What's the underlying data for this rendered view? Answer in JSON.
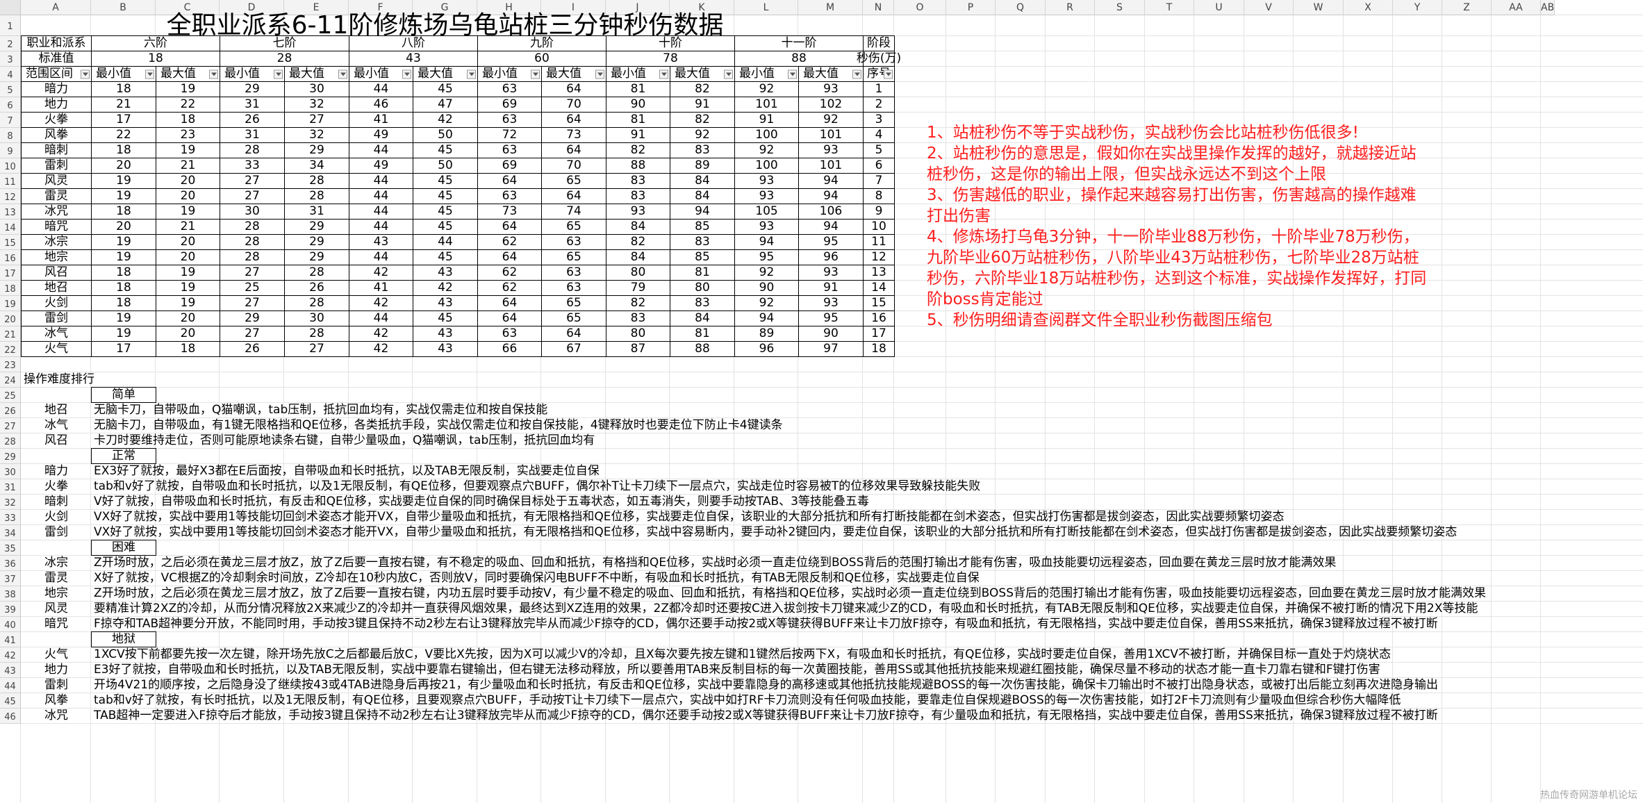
{
  "title": "全职业派系6-11阶修炼场乌龟站桩三分钟秒伤数据",
  "column_headers": [
    "A",
    "B",
    "C",
    "D",
    "E",
    "F",
    "G",
    "H",
    "I",
    "J",
    "K",
    "L",
    "M",
    "N",
    "O",
    "P",
    "Q",
    "R",
    "S",
    "T",
    "U",
    "V",
    "W",
    "X",
    "Y",
    "Z",
    "AA",
    "AB"
  ],
  "row_numbers": [
    "1",
    "2",
    "3",
    "4",
    "5",
    "6",
    "7",
    "8",
    "9",
    "10",
    "11",
    "12",
    "13",
    "14",
    "15",
    "16",
    "17",
    "18",
    "19",
    "20",
    "21",
    "22",
    "23",
    "24",
    "25",
    "26",
    "27",
    "28",
    "29",
    "30",
    "31",
    "32",
    "33",
    "34",
    "35",
    "36",
    "37",
    "38",
    "39",
    "40",
    "41",
    "42",
    "43",
    "44",
    "45",
    "46"
  ],
  "table": {
    "row2": {
      "a": "职业和派系",
      "tiers": [
        "六阶",
        "七阶",
        "八阶",
        "九阶",
        "十阶",
        "十一阶"
      ],
      "stage": "阶段"
    },
    "row3": {
      "a": "标准值",
      "standards": [
        "18",
        "28",
        "43",
        "60",
        "78",
        "88"
      ],
      "unit": "秒伤(万)"
    },
    "row4": {
      "a": "范围区间",
      "min": "最小值",
      "max": "最大值",
      "seq": "序号"
    },
    "rows": [
      {
        "name": "暗力",
        "v": [
          "18",
          "19",
          "29",
          "30",
          "44",
          "45",
          "63",
          "64",
          "81",
          "82",
          "92",
          "93"
        ],
        "n": "1"
      },
      {
        "name": "地力",
        "v": [
          "21",
          "22",
          "31",
          "32",
          "46",
          "47",
          "69",
          "70",
          "90",
          "91",
          "101",
          "102"
        ],
        "n": "2"
      },
      {
        "name": "火拳",
        "v": [
          "17",
          "18",
          "26",
          "27",
          "41",
          "42",
          "63",
          "64",
          "81",
          "82",
          "91",
          "92"
        ],
        "n": "3"
      },
      {
        "name": "风拳",
        "v": [
          "22",
          "23",
          "31",
          "32",
          "49",
          "50",
          "72",
          "73",
          "91",
          "92",
          "100",
          "101"
        ],
        "n": "4"
      },
      {
        "name": "暗刺",
        "v": [
          "18",
          "19",
          "28",
          "29",
          "44",
          "45",
          "63",
          "64",
          "82",
          "83",
          "92",
          "93"
        ],
        "n": "5"
      },
      {
        "name": "雷刺",
        "v": [
          "20",
          "21",
          "33",
          "34",
          "49",
          "50",
          "69",
          "70",
          "88",
          "89",
          "100",
          "101"
        ],
        "n": "6"
      },
      {
        "name": "风灵",
        "v": [
          "19",
          "20",
          "27",
          "28",
          "44",
          "45",
          "64",
          "65",
          "83",
          "84",
          "93",
          "94"
        ],
        "n": "7"
      },
      {
        "name": "雷灵",
        "v": [
          "19",
          "20",
          "27",
          "28",
          "44",
          "45",
          "63",
          "64",
          "83",
          "84",
          "93",
          "94"
        ],
        "n": "8"
      },
      {
        "name": "冰咒",
        "v": [
          "18",
          "19",
          "30",
          "31",
          "44",
          "45",
          "73",
          "74",
          "93",
          "94",
          "105",
          "106"
        ],
        "n": "9"
      },
      {
        "name": "暗咒",
        "v": [
          "20",
          "21",
          "28",
          "29",
          "44",
          "45",
          "64",
          "65",
          "84",
          "85",
          "93",
          "94"
        ],
        "n": "10"
      },
      {
        "name": "冰宗",
        "v": [
          "19",
          "20",
          "28",
          "29",
          "43",
          "44",
          "62",
          "63",
          "82",
          "83",
          "94",
          "95"
        ],
        "n": "11"
      },
      {
        "name": "地宗",
        "v": [
          "19",
          "20",
          "28",
          "29",
          "44",
          "45",
          "64",
          "65",
          "84",
          "85",
          "95",
          "96"
        ],
        "n": "12"
      },
      {
        "name": "风召",
        "v": [
          "18",
          "19",
          "27",
          "28",
          "42",
          "43",
          "62",
          "63",
          "80",
          "81",
          "92",
          "93"
        ],
        "n": "13"
      },
      {
        "name": "地召",
        "v": [
          "18",
          "19",
          "25",
          "26",
          "41",
          "42",
          "62",
          "63",
          "79",
          "80",
          "90",
          "91"
        ],
        "n": "14"
      },
      {
        "name": "火剑",
        "v": [
          "18",
          "19",
          "27",
          "28",
          "42",
          "43",
          "64",
          "65",
          "82",
          "83",
          "92",
          "93"
        ],
        "n": "15"
      },
      {
        "name": "雷剑",
        "v": [
          "19",
          "20",
          "29",
          "30",
          "44",
          "45",
          "64",
          "65",
          "83",
          "84",
          "94",
          "95"
        ],
        "n": "16"
      },
      {
        "name": "冰气",
        "v": [
          "19",
          "20",
          "27",
          "28",
          "42",
          "43",
          "63",
          "64",
          "80",
          "81",
          "89",
          "90"
        ],
        "n": "17"
      },
      {
        "name": "火气",
        "v": [
          "17",
          "18",
          "26",
          "27",
          "42",
          "43",
          "66",
          "67",
          "87",
          "88",
          "96",
          "97"
        ],
        "n": "18"
      }
    ]
  },
  "notes": [
    "1、站桩秒伤不等于实战秒伤，实战秒伤会比站桩秒伤低很多!",
    "2、站桩秒伤的意思是，假如你在实战里操作发挥的越好，就越接近站桩秒伤，这是你的输出上限，但实战永远达不到这个上限",
    "3、伤害越低的职业，操作起来越容易打出伤害，伤害越高的操作越难打出伤害",
    "4、修炼场打乌龟3分钟，十一阶毕业88万秒伤，十阶毕业78万秒伤，九阶毕业60万站桩秒伤，八阶毕业43万站桩秒伤，七阶毕业28万站桩秒伤，六阶毕业18万站桩秒伤，达到这个标准，实战操作发挥好，打同阶boss肯定能过",
    "5、秒伤明细请查阅群文件全职业秒伤截图压缩包"
  ],
  "difficulty": {
    "heading": "操作难度排行",
    "lines": [
      {
        "type": "group",
        "label": "简单"
      },
      {
        "type": "item",
        "name": "地召",
        "text": "无脑卡刀，自带吸血，Q猫嘲讽，tab压制，抵抗回血均有，实战仅需走位和按自保技能"
      },
      {
        "type": "item",
        "name": "冰气",
        "text": "无脑卡刀，自带吸血，有1键无限格挡和QE位移，各类抵抗手段，实战仅需走位和按自保技能，4键释放时也要走位下防止卡4键读条"
      },
      {
        "type": "item",
        "name": "风召",
        "text": "卡刀时要维持走位，否则可能原地读条右键，自带少量吸血，Q猫嘲讽，tab压制，抵抗回血均有"
      },
      {
        "type": "group",
        "label": "正常"
      },
      {
        "type": "item",
        "name": "暗力",
        "text": "EX3好了就按，最好X3都在E后面按，自带吸血和长时抵抗，以及TAB无限反制，实战要走位自保"
      },
      {
        "type": "item",
        "name": "火拳",
        "text": "tab和v好了就按，自带吸血和长时抵抗，以及1无限反制，有QE位移，但要观察点穴BUFF，偶尔补T让卡刀续下一层点穴，实战走位时容易被T的位移效果导致躲技能失败"
      },
      {
        "type": "item",
        "name": "暗刺",
        "text": "V好了就按，自带吸血和长时抵抗，有反击和QE位移，实战要走位自保的同时确保目标处于五毒状态，如五毒消失，则要手动按TAB、3等技能叠五毒"
      },
      {
        "type": "item",
        "name": "火剑",
        "text": "VX好了就按，实战中要用1等技能切回剑术姿态才能开VX，自带少量吸血和抵抗，有无限格挡和QE位移，实战要走位自保，该职业的大部分抵抗和所有打断技能都在剑术姿态，但实战打伤害都是拔剑姿态，因此实战要频繁切姿态"
      },
      {
        "type": "item",
        "name": "雷剑",
        "text": "VX好了就按，实战中要用1等技能切回剑术姿态才能开VX，自带少量吸血和抵抗，有无限格挡和QE位移，实战中容易断内，要手动补2键回内，要走位自保，该职业的大部分抵抗和所有打断技能都在剑术姿态，但实战打伤害都是拔剑姿态，因此实战要频繁切姿态"
      },
      {
        "type": "group",
        "label": "困难"
      },
      {
        "type": "item",
        "name": "冰宗",
        "text": "Z开场时放，之后必须在黄龙三层才放Z，放了Z后要一直按右键，有不稳定的吸血、回血和抵抗，有格挡和QE位移，实战时必须一直走位绕到BOSS背后的范围打输出才能有伤害，吸血技能要切远程姿态，回血要在黄龙三层时放才能满效果"
      },
      {
        "type": "item",
        "name": "雷灵",
        "text": "X好了就按，VC根据Z的冷却剩余时间放，Z冷却在10秒内放C，否则放V，同时要确保闪电BUFF不中断，有吸血和长时抵抗，有TAB无限反制和QE位移，实战要走位自保"
      },
      {
        "type": "item",
        "name": "地宗",
        "text": "Z开场时放，之后必须在黄龙三层才放Z，放了Z后要一直按右键，内功五层时要手动按V，有少量不稳定的吸血、回血和抵抗，有格挡和QE位移，实战时必须一直走位绕到BOSS背后的范围打输出才能有伤害，吸血技能要切远程姿态，回血要在黄龙三层时放才能满效果"
      },
      {
        "type": "item",
        "name": "风灵",
        "text": "要精准计算2XZ的冷却，从而分情况释放2X来减少Z的冷却并一直获得风烟效果，最终达到XZ连用的效果，2Z都冷却时还要按C进入拔剑按卡刀键来减少Z的CD，有吸血和长时抵抗，有TAB无限反制和QE位移，实战要走位自保，并确保不被打断的情况下用2X等技能"
      },
      {
        "type": "item",
        "name": "暗咒",
        "text": "F掠夺和TAB超神要分开放，不能同时用，手动按3键且保持不动2秒左右让3键释放完毕从而减少F掠夺的CD，偶尔还要手动按2或X等键获得BUFF来让卡刀放F掠夺，有吸血和抵抗，有无限格挡，实战中要走位自保，善用SS来抵抗，确保3键释放过程不被打断"
      },
      {
        "type": "group",
        "label": "地狱"
      },
      {
        "type": "item",
        "name": "火气",
        "text": "1XCV按下前都要先按一次左键，除开场先放C之后都最后放C，V要比X先按，因为X可以减少V的冷却，且X每次要先按左键和1键然后按两下X，有吸血和长时抵抗，有QE位移，实战时要走位自保，善用1XCV不被打断，并确保目标一直处于灼烧状态"
      },
      {
        "type": "item",
        "name": "地力",
        "text": "E3好了就按，自带吸血和长时抵抗，以及TAB无限反制，实战中要靠右键输出，但右键无法移动释放，所以要善用TAB来反制目标的每一次黄圈技能，善用SS或其他抵抗技能来规避红圈技能，确保尽量不移动的状态才能一直卡刀靠右键和F键打伤害"
      },
      {
        "type": "item",
        "name": "雷刺",
        "text": "开场4V21的顺序按，之后隐身没了继续按43或4TAB进隐身后再按21，有少量吸血和长时抵抗，有反击和QE位移，实战中要靠隐身的高移速或其他抵抗技能规避BOSS的每一次伤害技能，确保卡刀输出时不被打出隐身状态，或被打出后能立刻再次进隐身输出"
      },
      {
        "type": "item",
        "name": "风拳",
        "text": "tab和v好了就按，有长时抵抗，以及1无限反制，有QE位移，且要观察点穴BUFF，手动按T让卡刀续下一层点穴，实战中如打RF卡刀流则没有任何吸血技能，要靠走位自保规避BOSS的每一次伤害技能，如打2F卡刀流则有少量吸血但综合秒伤大幅降低"
      },
      {
        "type": "item",
        "name": "冰咒",
        "text": "TAB超神一定要进入F掠夺后才能放，手动按3键且保持不动2秒左右让3键释放完毕从而减少F掠夺的CD，偶尔还要手动按2或X等键获得BUFF来让卡刀放F掠夺，有少量吸血和抵抗，有无限格挡，实战中要走位自保，善用SS来抵抗，确保3键释放过程不被打断"
      }
    ]
  },
  "watermark": "热血传奇网游单机论坛"
}
